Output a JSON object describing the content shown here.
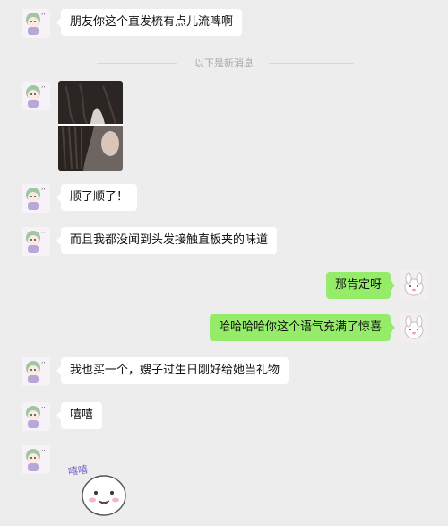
{
  "chat": {
    "divider_label": "以下是新消息",
    "messages": [
      {
        "from": "friend",
        "type": "text",
        "text": "朋友你这个直发梳有点儿流啤啊"
      },
      {
        "from": "friend",
        "type": "image",
        "description": "two photos of hair"
      },
      {
        "from": "friend",
        "type": "text",
        "text": "顺了顺了！"
      },
      {
        "from": "friend",
        "type": "text",
        "text": "而且我都没闻到头发接触直板夹的味道"
      },
      {
        "from": "me",
        "type": "text",
        "text": "那肯定呀"
      },
      {
        "from": "me",
        "type": "text",
        "text": "哈哈哈哈你这个语气充满了惊喜"
      },
      {
        "from": "friend",
        "type": "text",
        "text": "我也买一个，嫂子过生日刚好给她当礼物"
      },
      {
        "from": "friend",
        "type": "text",
        "text": "嘻嘻"
      },
      {
        "from": "friend",
        "type": "sticker",
        "sticker_text": "嘻嘻"
      }
    ]
  },
  "colors": {
    "background": "#ededed",
    "incoming_bubble": "#ffffff",
    "outgoing_bubble": "#95ec69",
    "divider_text": "#aaaaaa"
  },
  "icons": {
    "friend_avatar": "cartoon-girl-avatar-icon",
    "my_avatar": "cartoon-bunny-avatar-icon"
  }
}
